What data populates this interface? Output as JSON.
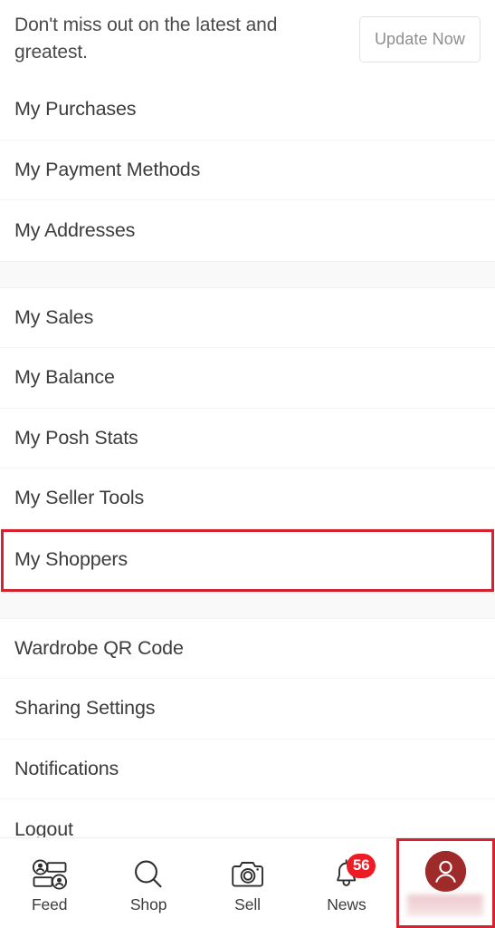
{
  "banner": {
    "message": "Don't miss out on the latest and greatest.",
    "button_label": "Update Now"
  },
  "menu": {
    "groups": [
      {
        "items": [
          {
            "label": "My Purchases",
            "name": "my-purchases",
            "highlighted": false
          },
          {
            "label": "My Payment Methods",
            "name": "my-payment-methods",
            "highlighted": false
          },
          {
            "label": "My Addresses",
            "name": "my-addresses",
            "highlighted": false
          }
        ]
      },
      {
        "items": [
          {
            "label": "My Sales",
            "name": "my-sales",
            "highlighted": false
          },
          {
            "label": "My Balance",
            "name": "my-balance",
            "highlighted": false
          },
          {
            "label": "My Posh Stats",
            "name": "my-posh-stats",
            "highlighted": false
          },
          {
            "label": "My Seller Tools",
            "name": "my-seller-tools",
            "highlighted": false
          },
          {
            "label": "My Shoppers",
            "name": "my-shoppers",
            "highlighted": true
          }
        ]
      },
      {
        "items": [
          {
            "label": "Wardrobe QR Code",
            "name": "wardrobe-qr-code",
            "highlighted": false
          },
          {
            "label": "Sharing Settings",
            "name": "sharing-settings",
            "highlighted": false
          },
          {
            "label": "Notifications",
            "name": "notifications",
            "highlighted": false
          },
          {
            "label": "Logout",
            "name": "logout",
            "highlighted": false
          }
        ]
      }
    ]
  },
  "tabbar": {
    "tabs": [
      {
        "label": "Feed",
        "icon": "feed-icon",
        "name": "feed",
        "badge": null
      },
      {
        "label": "Shop",
        "icon": "search-icon",
        "name": "shop",
        "badge": null
      },
      {
        "label": "Sell",
        "icon": "camera-icon",
        "name": "sell",
        "badge": null
      },
      {
        "label": "News",
        "icon": "bell-icon",
        "name": "news",
        "badge": "56"
      },
      {
        "label": "",
        "icon": "avatar-icon",
        "name": "profile",
        "badge": null
      }
    ]
  },
  "colors": {
    "annotation": "#d42231",
    "badge": "#ed1c24",
    "avatar": "#9e2a2a",
    "text": "#3c3c3c",
    "muted_text": "#8e8e8e"
  }
}
